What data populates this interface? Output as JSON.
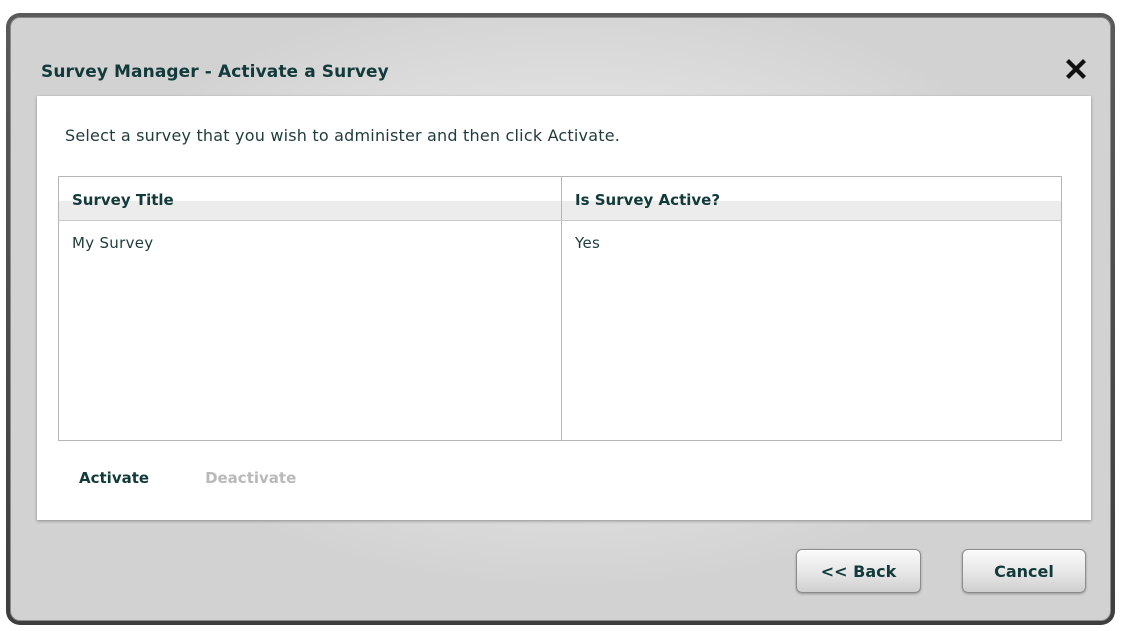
{
  "dialog": {
    "title": "Survey Manager - Activate a Survey",
    "close_icon": "close-icon"
  },
  "content": {
    "instruction": "Select a survey that you wish to administer and then click Activate.",
    "table": {
      "columns": [
        "Survey Title",
        "Is Survey Active?"
      ],
      "rows": [
        {
          "title": "My Survey",
          "active": "Yes"
        }
      ]
    },
    "actions": {
      "activate_label": "Activate",
      "deactivate_label": "Deactivate"
    }
  },
  "footer": {
    "back_label": "<< Back",
    "cancel_label": "Cancel"
  },
  "colors": {
    "text_dark": "#123a3a",
    "disabled_text": "#b9b9b9",
    "frame": "#4a4a4a"
  }
}
